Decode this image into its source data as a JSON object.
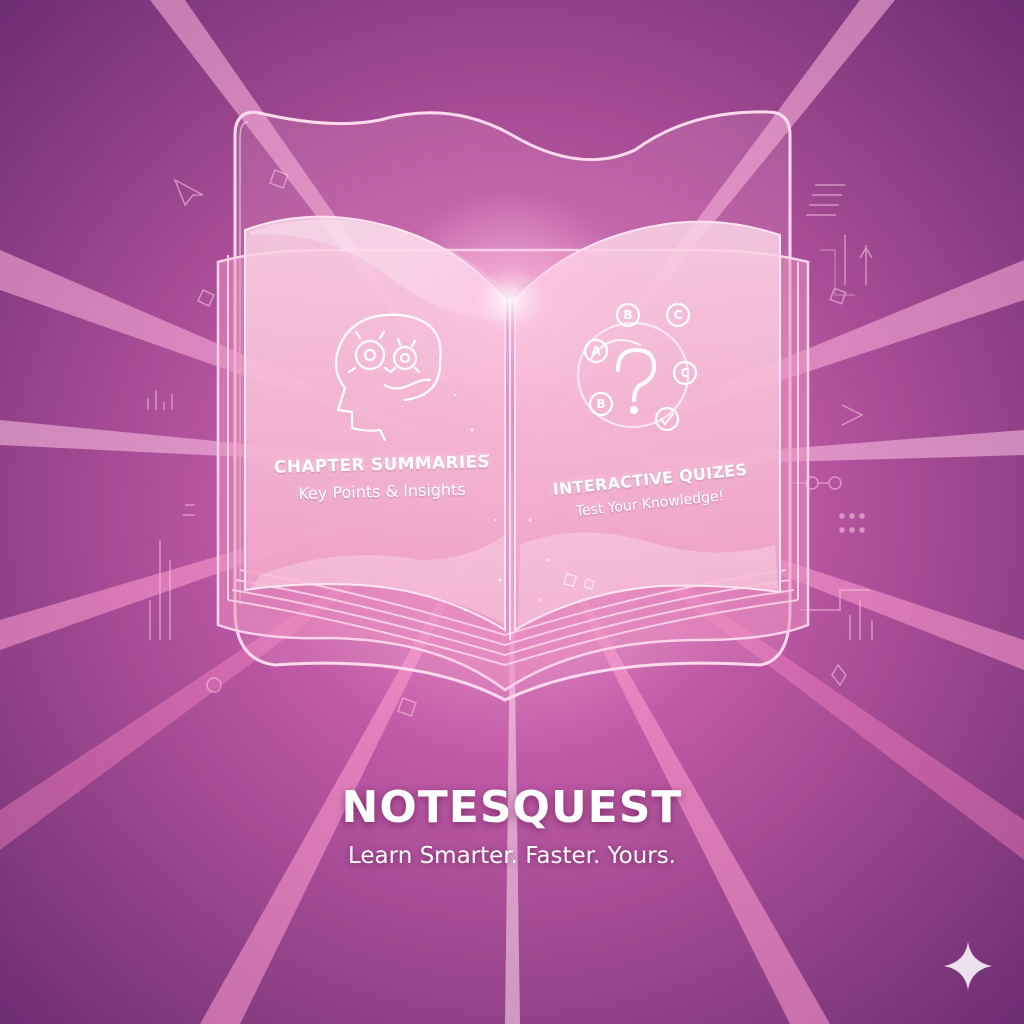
{
  "book": {
    "left_page": {
      "title": "CHAPTER SUMMARIES",
      "subtitle": "Key Points & Insights",
      "icon": "brain-gears-icon"
    },
    "right_page": {
      "title": "INTERACTIVE QUIZES",
      "subtitle": "Test Your Knowledge!",
      "icon": "question-quiz-icon",
      "options": [
        "A",
        "B",
        "C",
        "C",
        "B"
      ]
    }
  },
  "brand": {
    "title": "NOTESQUEST",
    "tagline": "Learn Smarter. Faster. Yours."
  },
  "colors": {
    "background": "#8a3f86",
    "accent": "#ff7fc2",
    "page": "#f7c6dc",
    "outline": "#ffd6ea"
  },
  "decor": {
    "corner_icon": "sparkle-icon"
  }
}
